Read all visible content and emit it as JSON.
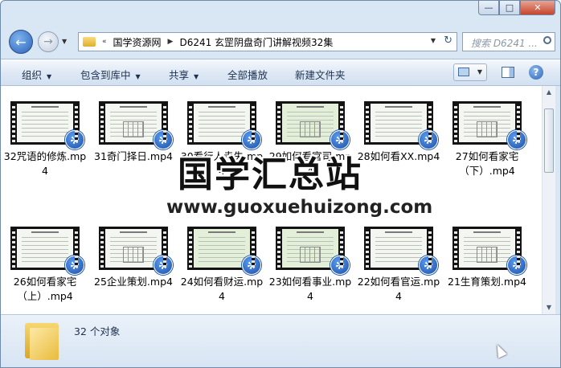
{
  "window": {
    "minimize_glyph": "—",
    "maximize_glyph": "□",
    "close_glyph": "✕"
  },
  "nav": {
    "back_glyph": "←",
    "forward_glyph": "→",
    "breadcrumb_prefix": "«",
    "breadcrumbs": [
      "国学资源网",
      "D6241 玄罡阴盘奇门讲解视频32集"
    ],
    "search_placeholder": "搜索 D6241 ..."
  },
  "toolbar": {
    "organize": "组织",
    "include_in_library": "包含到库中",
    "share": "共享",
    "play_all": "全部播放",
    "new_folder": "新建文件夹",
    "help_glyph": "?"
  },
  "files_row1": [
    {
      "name": "32咒语的修炼.mp4",
      "tint": "white"
    },
    {
      "name": "31奇门择日.mp4",
      "tint": "white"
    },
    {
      "name": "30看行人走失.mp4",
      "tint": "white"
    },
    {
      "name": "29如何看官司.mp4",
      "tint": "green"
    },
    {
      "name": "28如何看XX.mp4",
      "tint": "white"
    },
    {
      "name": "27如何看家宅（下）.mp4",
      "tint": "white"
    }
  ],
  "files_row2": [
    {
      "name": "26如何看家宅（上）.mp4",
      "tint": "white"
    },
    {
      "name": "25企业策划.mp4",
      "tint": "white"
    },
    {
      "name": "24如何看财运.mp4",
      "tint": "green"
    },
    {
      "name": "23如何看事业.mp4",
      "tint": "green"
    },
    {
      "name": "22如何看官运.mp4",
      "tint": "white"
    },
    {
      "name": "21生育策划.mp4",
      "tint": "white"
    }
  ],
  "watermark": {
    "title": "国学汇总站",
    "url": "www.guoxuehuizong.com"
  },
  "status": {
    "item_count": "32 个对象"
  }
}
